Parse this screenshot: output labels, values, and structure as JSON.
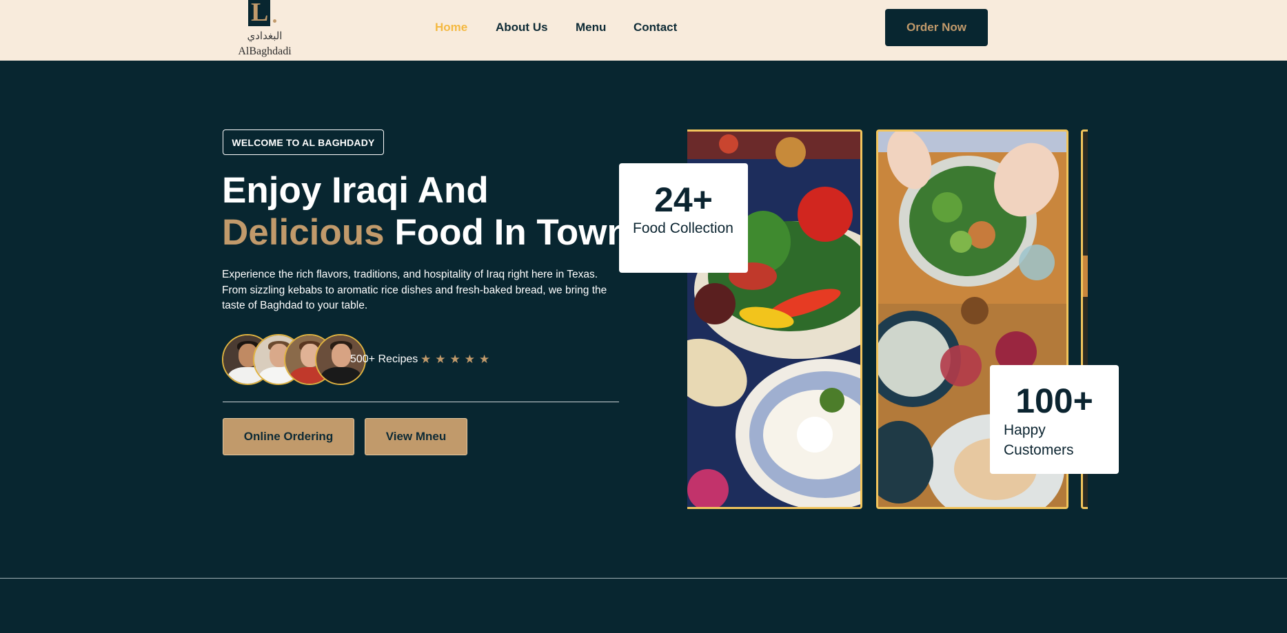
{
  "header": {
    "logo": {
      "monogram": "L",
      "arabic": "البغدادي",
      "latin": "AlBaghdadi"
    },
    "nav": [
      {
        "label": "Home",
        "active": true
      },
      {
        "label": "About Us",
        "active": false
      },
      {
        "label": "Menu",
        "active": false
      },
      {
        "label": "Contact",
        "active": false
      }
    ],
    "cta_label": "Order Now"
  },
  "hero": {
    "badge": "WELCOME TO AL BAGHDADY",
    "title_line1": "Enjoy Iraqi And",
    "title_accent": "Delicious",
    "title_line2_rest": " Food In Town",
    "description": "Experience the rich flavors, traditions, and hospitality of Iraq right here in Texas. From sizzling kebabs to aromatic rice dishes and fresh-baked bread, we bring the taste of Baghdad to your table.",
    "recipes_label": "500+ Recipes",
    "rating": 5,
    "star_icon": "star-icon",
    "buttons": {
      "online": "Online Ordering",
      "menu": "View Mneu"
    }
  },
  "stats": [
    {
      "number": "24+",
      "label": "Food Collection"
    },
    {
      "number": "100+",
      "label": "Happy Customers"
    }
  ],
  "colors": {
    "background": "#082630",
    "header_bg": "#f8ebdc",
    "accent_gold": "#c19a6b",
    "nav_active": "#f4b942",
    "panel_border": "#f2c55c"
  }
}
